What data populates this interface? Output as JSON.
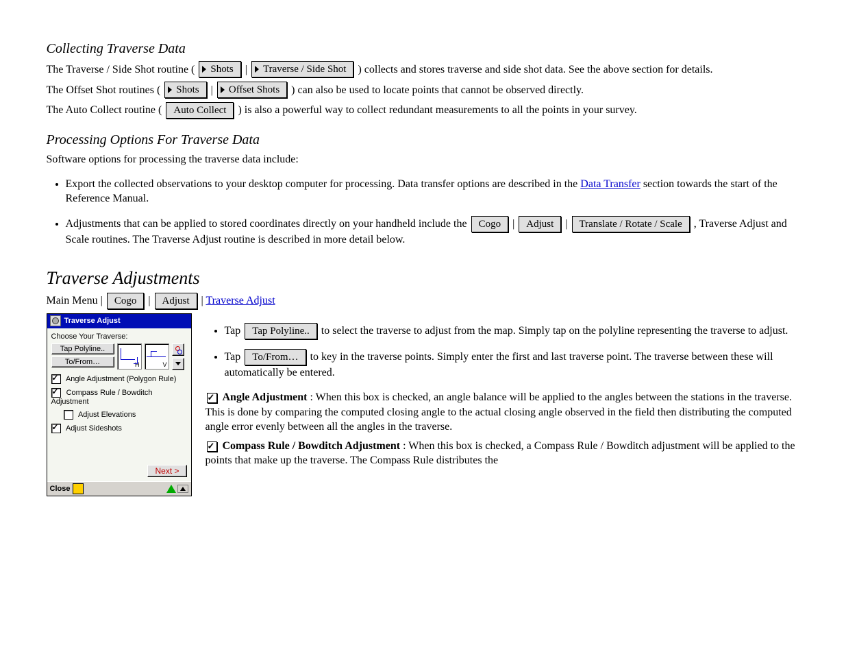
{
  "sec1": {
    "menu_shots": "Shots",
    "menu_traverse_side": "Traverse / Side Shot",
    "p1_prefix": "The Traverse / Side Shot routine (",
    "p1_mid": " | ",
    "p1_suffix": ") collects and stores traverse and side shot data. See the above section for details.",
    "menu_offset": "Offset Shots",
    "p2_prefix": "The Offset Shot routines (",
    "p2_mid": " | ",
    "p2_suffix": ") can also be used to locate points that cannot be observed directly.",
    "menu_auto": "Auto Collect",
    "p3_prefix": "The Auto Collect routine (",
    "p3_suffix": ") is also a powerful way to collect redundant measurements to all the points in your survey."
  },
  "sec2": {
    "intro": "Software options for processing the traverse data include:",
    "b1_prefix": "Export the collected observations to your desktop computer for processing. Data transfer options are described in the ",
    "b1_link": "Data Transfer",
    "b1_suffix": " section towards the start of the Reference Manual.",
    "btn_cogo": "Cogo",
    "btn_adjust": "Adjust",
    "btn_translate": "Translate / Rotate / Scale",
    "b2_prefix": "Adjustments that can be applied to stored coordinates directly on your handheld include the ",
    "b2_mid1": " | ",
    "b2_mid2": " | ",
    "b2_suffix": ", Traverse Adjust and Scale routines. The Traverse Adjust routine is described in more detail below.",
    "link_traverse_adjust": "Traverse Adjust"
  },
  "titles": {
    "collecting": "Collecting Traverse Data",
    "processing": "Processing Options For Traverse Data",
    "main": "Traverse Adjustments"
  },
  "main": {
    "btn_cogo": "Cogo",
    "btn_adjust": "Adjust",
    "link_traverse_adjust": "Traverse Adjust",
    "intro_prefix": "Main Menu | ",
    "intro_mid1": " | ",
    "intro_mid2": " | ",
    "btn_tap_poly": "Tap Polyline..",
    "btn_to_from": "To/From…",
    "li1_prefix": "Tap ",
    "li1_suffix": " to select the traverse to adjust from the map. Simply tap on the polyline representing the traverse to adjust.",
    "li2_prefix": "Tap ",
    "li2_suffix": " to key in the traverse points. Simply enter the first and last traverse point. The traverse between these will automatically be entered.",
    "cb_angle_adj": "Angle Adjustment",
    "angle_para": ": When this box is checked, an angle balance will be applied to the angles between the stations in the traverse. This is done by comparing the computed closing angle to the actual closing angle observed in the field then distributing the computed angle error evenly between all the angles in the traverse.",
    "cb_compass": "Compass Rule / Bowditch Adjustment",
    "compass_para": ": When this box is checked, a Compass Rule / Bowditch adjustment will be applied to the points that make up the traverse. The Compass Rule distributes the"
  },
  "dlg": {
    "title": "Traverse Adjust",
    "choose": "Choose Your Traverse:",
    "tap_poly": "Tap Polyline..",
    "to_from": "To/From…",
    "angle_adj": "Angle Adjustment (Polygon Rule)",
    "compass": "Compass Rule / Bowditch Adjustment",
    "adjust_elev": "Adjust Elevations",
    "adjust_ss": "Adjust Sideshots",
    "next": "Next >",
    "close": "Close",
    "h": "H",
    "v": "V"
  }
}
